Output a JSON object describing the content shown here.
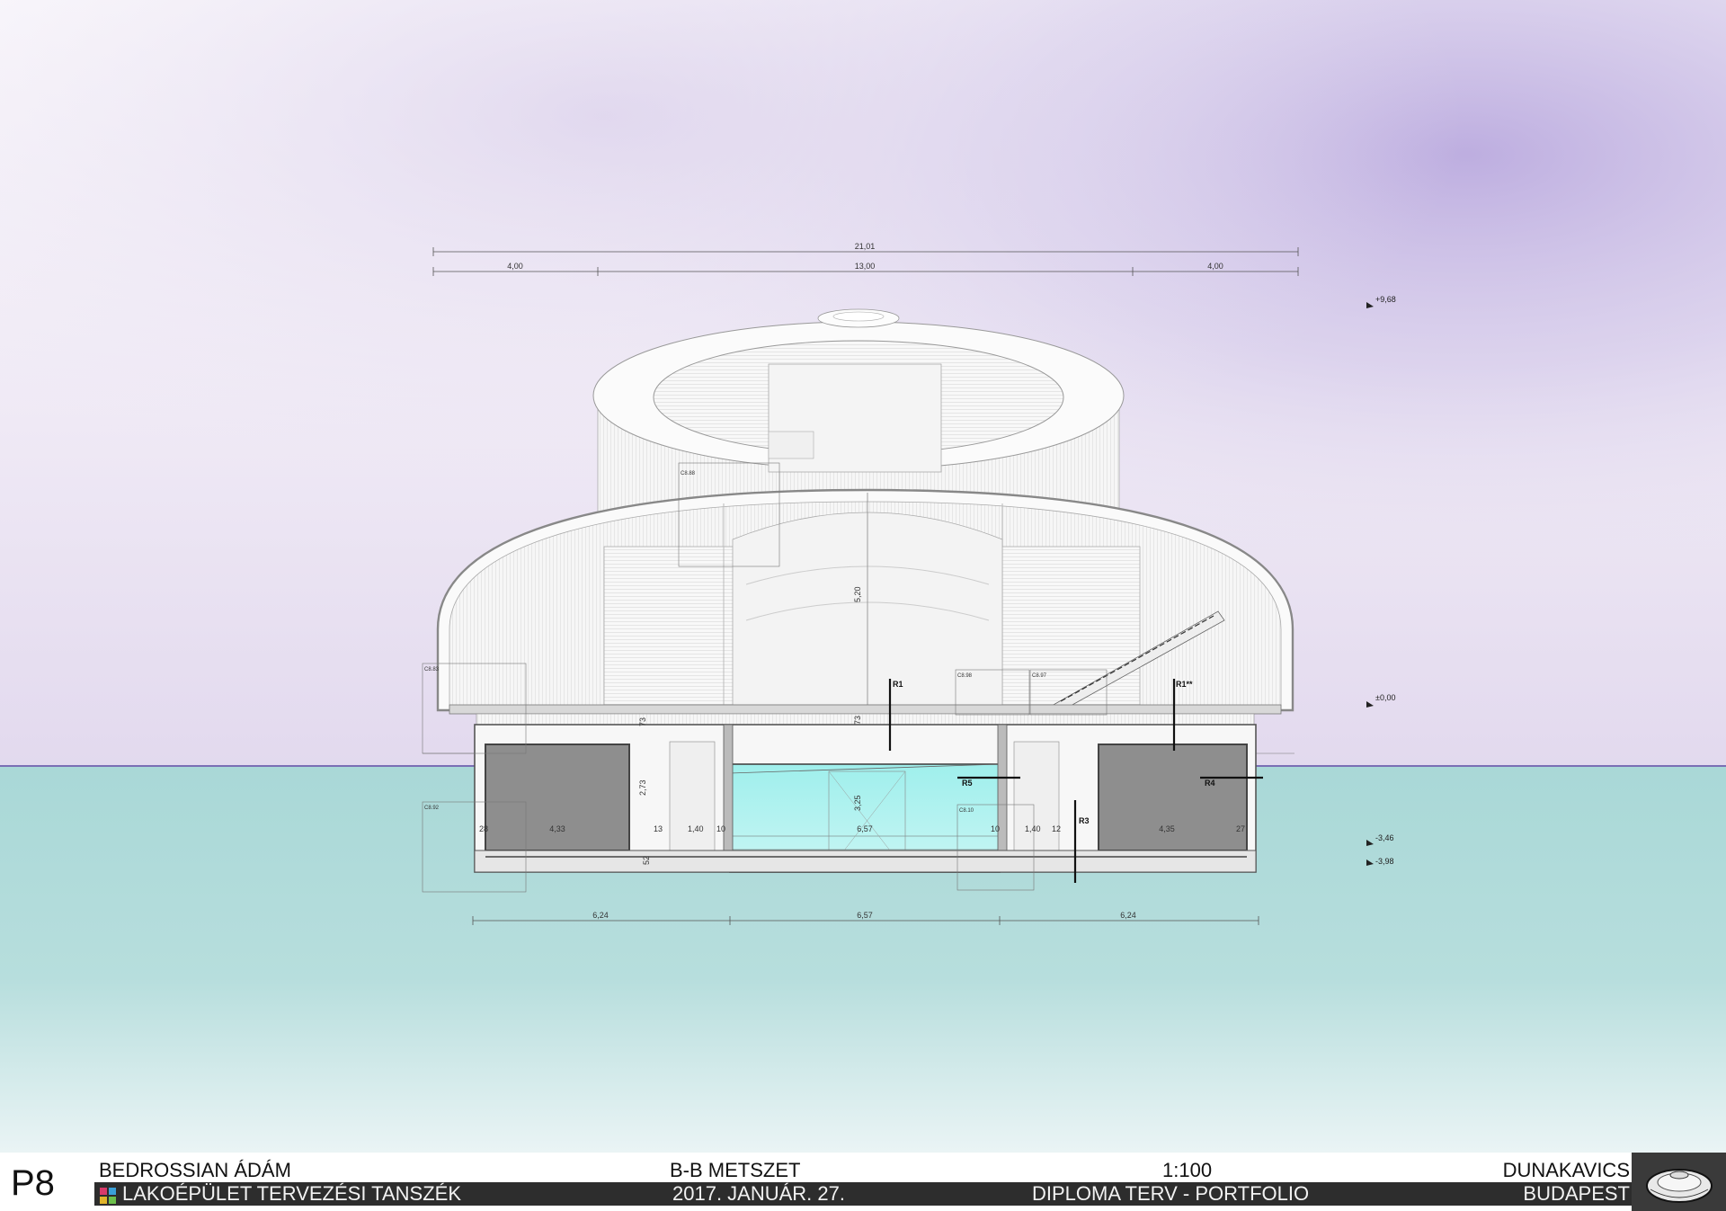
{
  "drawing": {
    "overall_dims": {
      "total": "21,01",
      "left": "4,00",
      "middle": "13,00",
      "right": "4,00"
    },
    "bottom_dims": {
      "left": "6,24",
      "middle": "6,57",
      "right": "6,24"
    },
    "interior_dims": {
      "left_room": "4,33",
      "left_wall": "28",
      "left_a": "13",
      "left_b": "1,40",
      "left_c": "10",
      "pool": "6,57",
      "right_a": "10",
      "right_b": "1,40",
      "right_c": "12",
      "right_room": "4,35",
      "right_wall": "27",
      "height_dome": "5,20",
      "height_floor": "73",
      "height_floor_left": "73",
      "height_lower": "2,73",
      "height_pool": "3,25",
      "slab": "52"
    },
    "levels": {
      "top": "+9,68",
      "ground": "±0,00",
      "low1": "-3,46",
      "low2": "-3,98"
    },
    "tags": {
      "r1": "R1",
      "r1b": "R1**",
      "r5": "R5",
      "r4": "R4",
      "r3": "R3"
    },
    "detail_boxes": [
      "C8.88",
      "C8.83",
      "C8.98",
      "C8.97",
      "C8.92",
      "C8.10"
    ]
  },
  "titleblock": {
    "sheet_no": "P8",
    "author": "BEDROSSIAN ÁDÁM",
    "department": "LAKOÉPÜLET TERVEZÉSI TANSZÉK",
    "sheet_title": "B-B METSZET",
    "date": "2017. JANUÁR. 27.",
    "scale": "1:100",
    "portfolio": "DIPLOMA TERV - PORTFOLIO",
    "project": "DUNAKAVICS",
    "city": "BUDAPEST"
  },
  "colors": {
    "sky_top": "#f7f4fa",
    "sky_violet": "#b9a9dc",
    "water": "#a6d6d6",
    "pool": "#a9f1ef",
    "room": "#8f8f8f"
  },
  "icons": [
    "pebble-logo-icon",
    "department-mark-icon",
    "level-marker-icon"
  ]
}
